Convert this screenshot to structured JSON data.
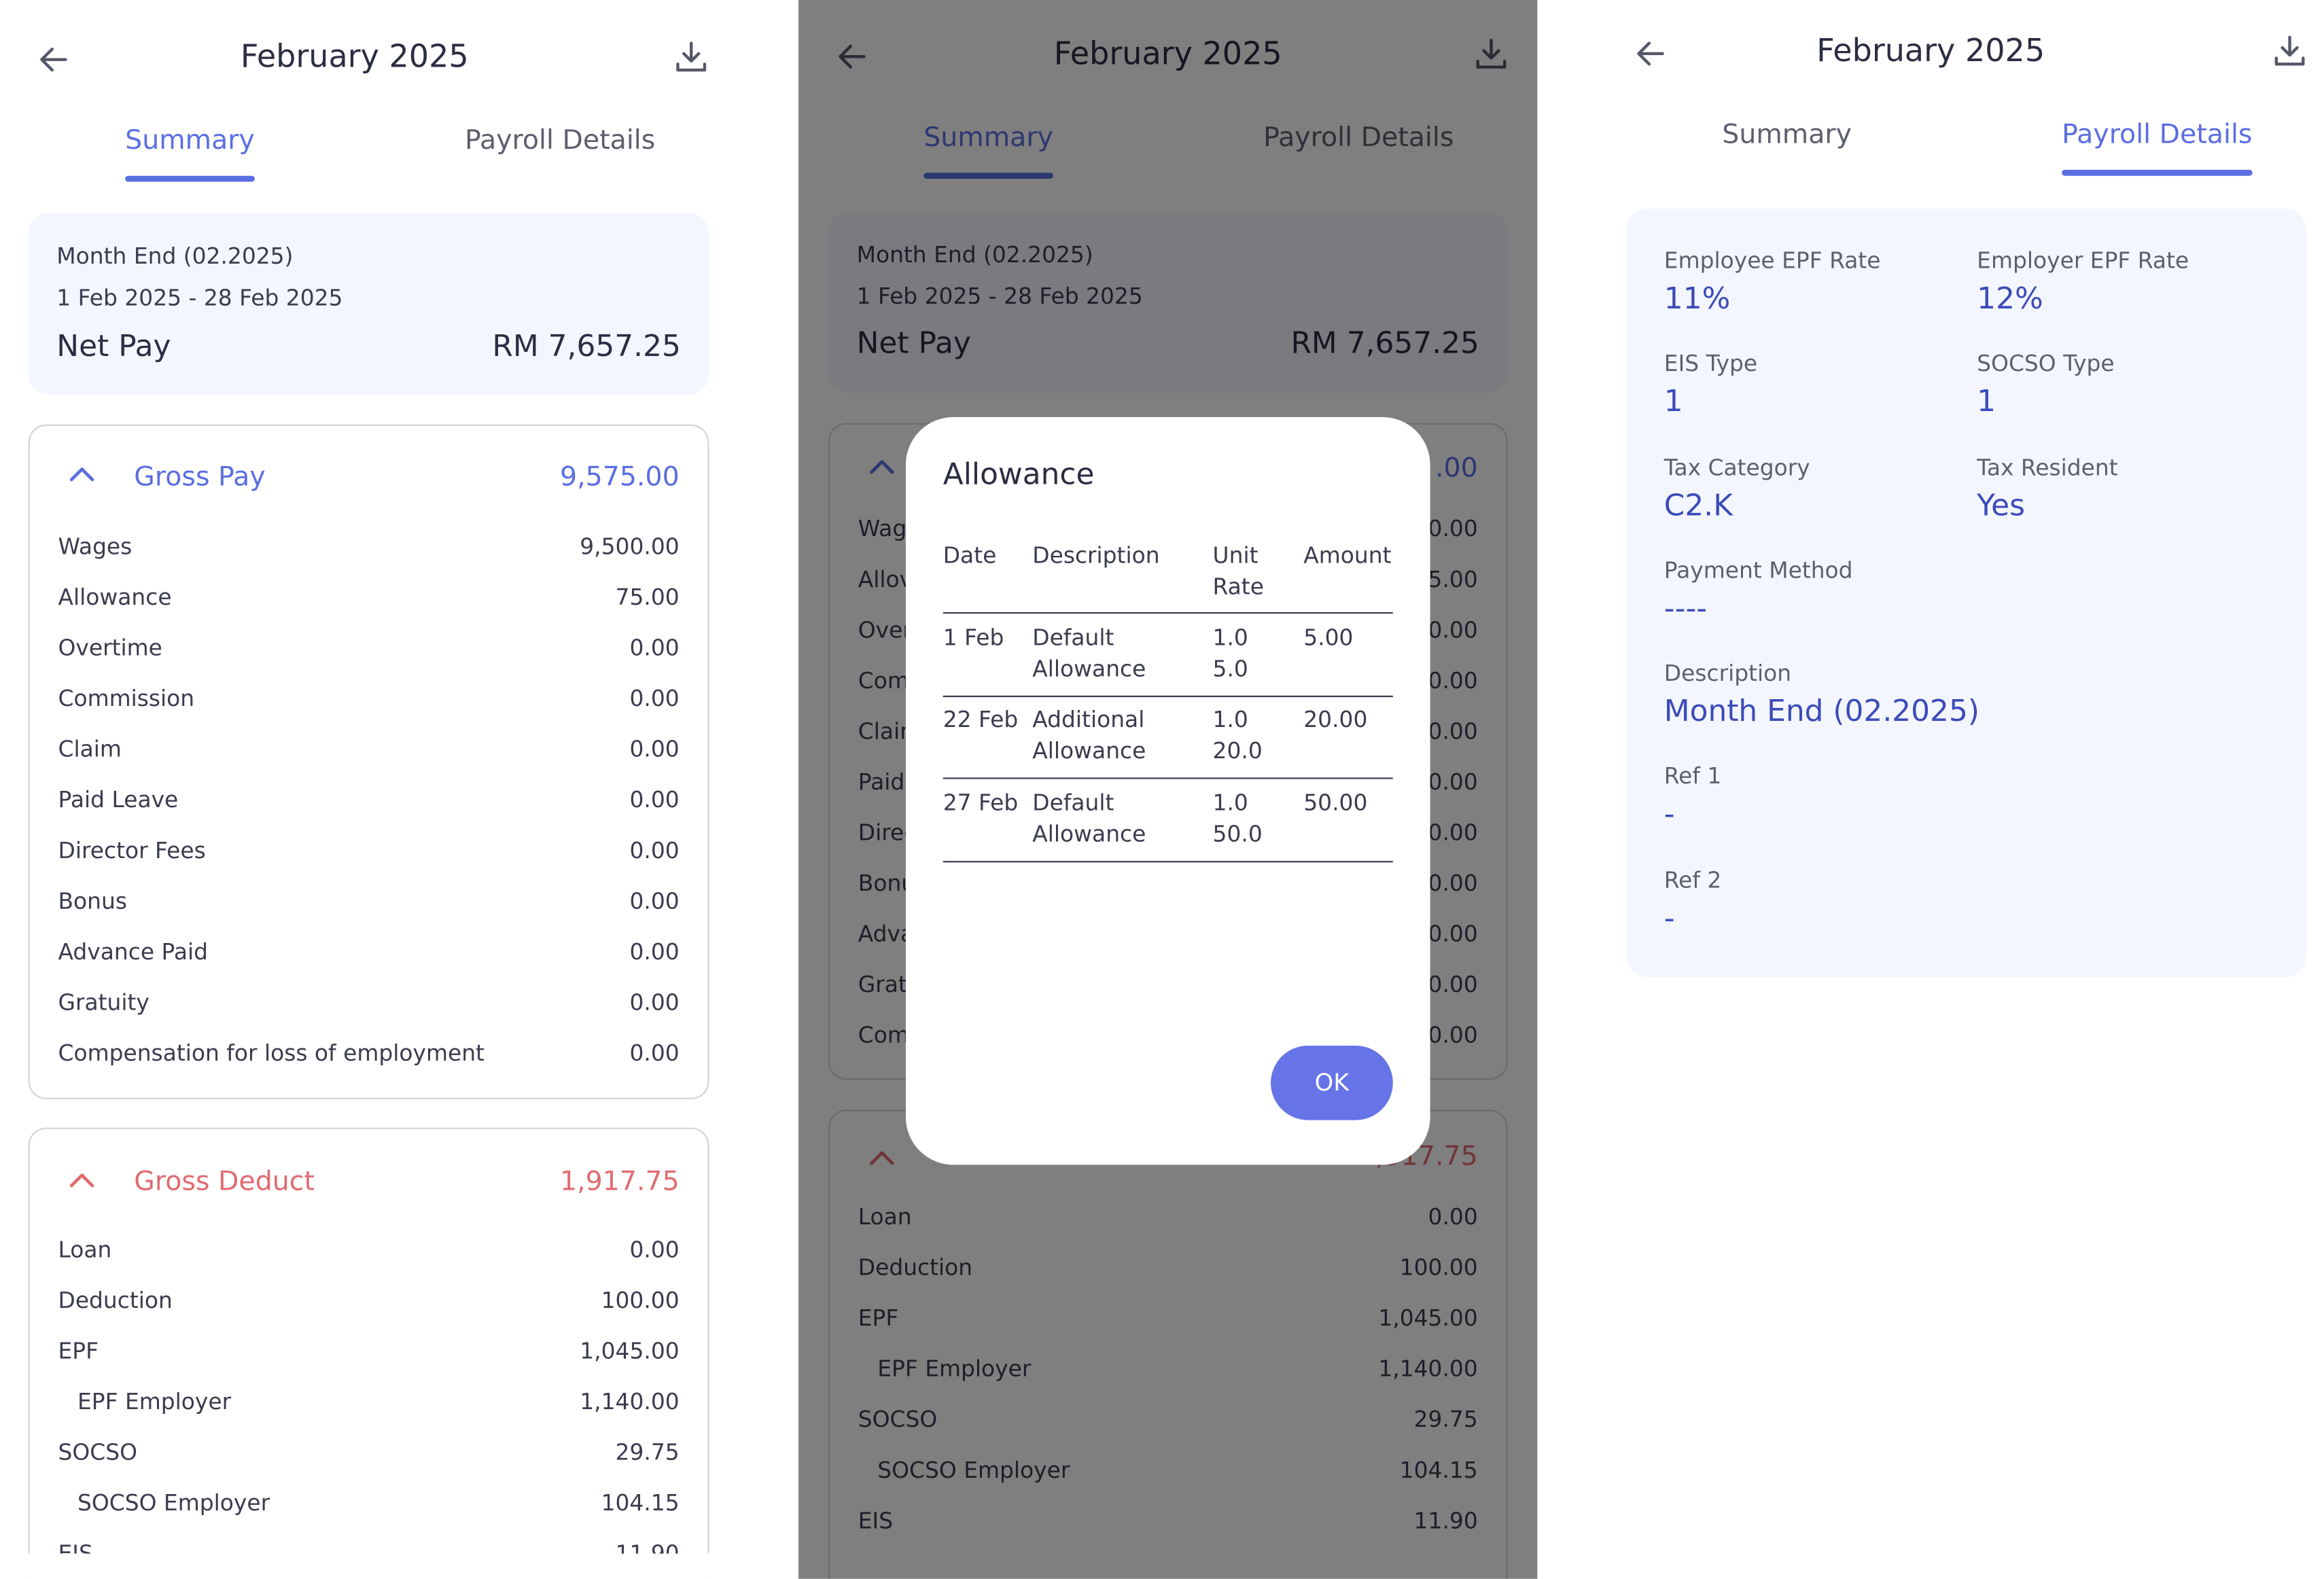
{
  "header": {
    "title": "February 2025"
  },
  "tabs": [
    {
      "label": "Summary"
    },
    {
      "label": "Payroll Details"
    }
  ],
  "summary_card": {
    "period_name": "Month End (02.2025)",
    "date_range": "1 Feb 2025 - 28 Feb 2025",
    "net_pay_label": "Net Pay",
    "net_pay_value": "RM 7,657.25"
  },
  "gross_pay": {
    "title": "Gross Pay",
    "total": "9,575.00",
    "color": "#5b6ee1",
    "rows": [
      {
        "label": "Wages",
        "value": "9,500.00"
      },
      {
        "label": "Allowance",
        "value": "75.00"
      },
      {
        "label": "Overtime",
        "value": "0.00"
      },
      {
        "label": "Commission",
        "value": "0.00"
      },
      {
        "label": "Claim",
        "value": "0.00"
      },
      {
        "label": "Paid Leave",
        "value": "0.00"
      },
      {
        "label": "Director Fees",
        "value": "0.00"
      },
      {
        "label": "Bonus",
        "value": "0.00"
      },
      {
        "label": "Advance Paid",
        "value": "0.00"
      },
      {
        "label": "Gratuity",
        "value": "0.00"
      },
      {
        "label": "Compensation for loss of employment",
        "value": "0.00"
      }
    ]
  },
  "gross_deduct": {
    "title": "Gross Deduct",
    "total": "1,917.75",
    "color": "#e06b70",
    "rows": [
      {
        "label": "Loan",
        "value": "0.00"
      },
      {
        "label": "Deduction",
        "value": "100.00"
      },
      {
        "label": "EPF",
        "value": "1,045.00"
      },
      {
        "label": "EPF Employer",
        "value": "1,140.00"
      },
      {
        "label": "SOCSO",
        "value": "29.75"
      },
      {
        "label": "SOCSO Employer",
        "value": "104.15"
      },
      {
        "label": "EIS",
        "value": "11.90"
      }
    ]
  },
  "middle_visible": {
    "gross_pay_total_tail": ".00",
    "gross_pay_label_heads": [
      "Wag",
      "Allov",
      "Over",
      "Com",
      "Clair",
      "Paid",
      "Direc",
      "Bonu",
      "Adva",
      "Grat",
      "Com"
    ],
    "gross_pay_value_tails": [
      "0.00",
      "5.00",
      "0.00",
      "0.00",
      "0.00",
      "0.00",
      "0.00",
      "0.00",
      "0.00",
      "0.00",
      "0.00"
    ],
    "gross_deduct_total_tail": ",917.75"
  },
  "dialog": {
    "title": "Allowance",
    "headers": {
      "date": "Date",
      "description": "Description",
      "unit_rate_1": "Unit",
      "unit_rate_2": "Rate",
      "amount": "Amount"
    },
    "rows": [
      {
        "date": "1 Feb",
        "desc1": "Default",
        "desc2": "Allowance",
        "unit": "1.0",
        "rate": "5.0",
        "amount": "5.00"
      },
      {
        "date": "22 Feb",
        "desc1": "Additional",
        "desc2": "Allowance",
        "unit": "1.0",
        "rate": "20.0",
        "amount": "20.00"
      },
      {
        "date": "27 Feb",
        "desc1": "Default",
        "desc2": "Allowance",
        "unit": "1.0",
        "rate": "50.0",
        "amount": "50.00"
      }
    ],
    "ok_label": "OK"
  },
  "details": {
    "employee_epf_rate": {
      "label": "Employee EPF Rate",
      "value": "11%"
    },
    "employer_epf_rate": {
      "label": "Employer EPF Rate",
      "value": "12%"
    },
    "eis_type": {
      "label": "EIS Type",
      "value": "1"
    },
    "socso_type": {
      "label": "SOCSO Type",
      "value": "1"
    },
    "tax_category": {
      "label": "Tax Category",
      "value": "C2.K"
    },
    "tax_resident": {
      "label": "Tax Resident",
      "value": "Yes"
    },
    "payment_method": {
      "label": "Payment Method",
      "value": "----"
    },
    "description": {
      "label": "Description",
      "value": "Month End (02.2025)"
    },
    "ref1": {
      "label": "Ref 1",
      "value": "-"
    },
    "ref2": {
      "label": "Ref 2",
      "value": "-"
    }
  },
  "icons": {
    "back": "arrow-left-icon",
    "download": "download-icon",
    "collapse": "chevron-up-icon"
  }
}
